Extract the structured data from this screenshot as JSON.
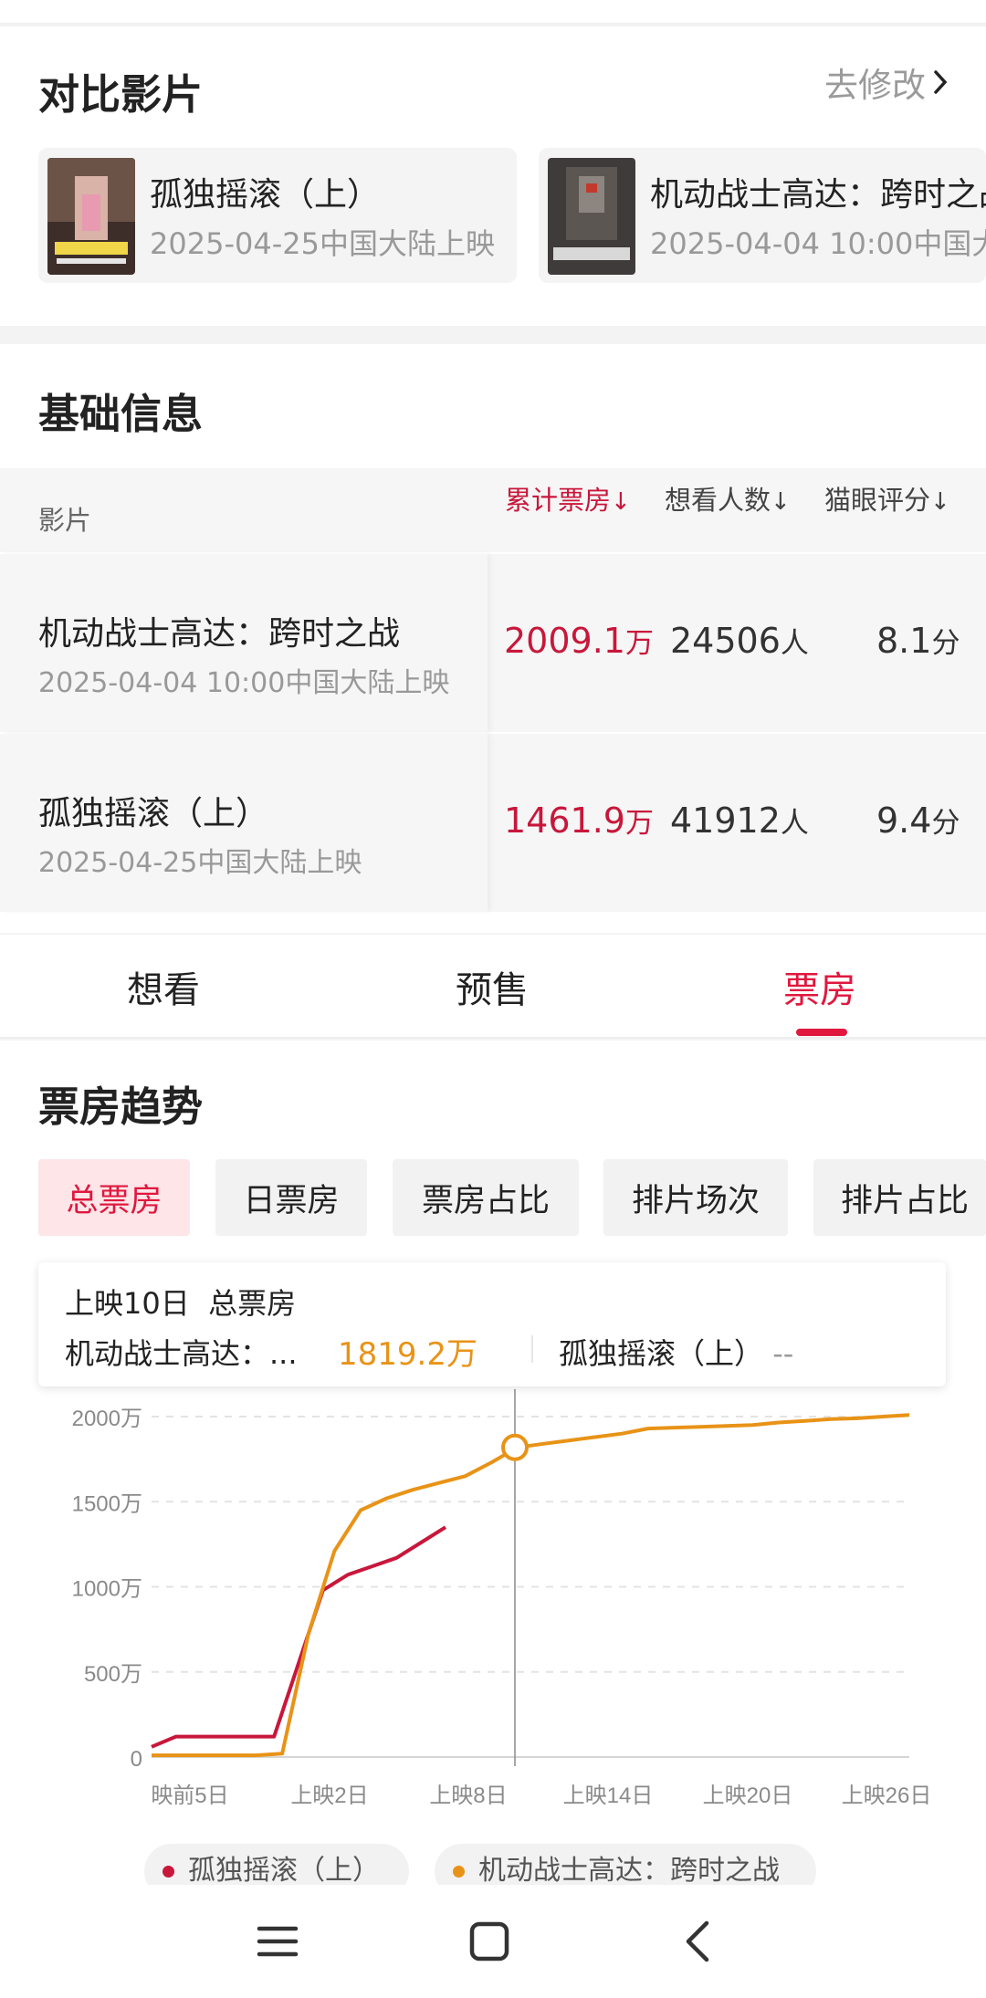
{
  "compare": {
    "title": "对比影片",
    "edit_label": "去修改",
    "films": [
      {
        "title": "孤独摇滚（上）",
        "date": "2025-04-25中国大陆上映"
      },
      {
        "title": "机动战士高达：跨时之战",
        "date": "2025-04-04 10:00中国大陆上映"
      }
    ]
  },
  "basic": {
    "title": "基础信息",
    "headers": {
      "film": "影片",
      "box": "累计票房",
      "want": "想看人数",
      "score": "猫眼评分"
    },
    "rows": [
      {
        "title": "机动战士高达：跨时之战",
        "date": "2025-04-04 10:00中国大陆上映",
        "box": "2009.1",
        "box_unit": "万",
        "want": "24506",
        "want_unit": "人",
        "score": "8.1",
        "score_unit": "分"
      },
      {
        "title": "孤独摇滚（上）",
        "date": "2025-04-25中国大陆上映",
        "box": "1461.9",
        "box_unit": "万",
        "want": "41912",
        "want_unit": "人",
        "score": "9.4",
        "score_unit": "分"
      }
    ]
  },
  "tabs": {
    "want": "想看",
    "presale": "预售",
    "box": "票房",
    "active": "票房"
  },
  "trend": {
    "title": "票房趋势",
    "pills": [
      "总票房",
      "日票房",
      "票房占比",
      "排片场次",
      "排片占比"
    ],
    "active_pill": "总票房",
    "tooltip": {
      "day": "上映10日",
      "metric": "总票房",
      "film_a": "机动战士高达：...",
      "film_a_value": "1819.2万",
      "film_b": "孤独摇滚（上）",
      "film_b_value": "--"
    },
    "legend": [
      "孤独摇滚（上）",
      "机动战士高达：跨时之战"
    ]
  },
  "chart_data": {
    "type": "line",
    "y_ticks": [
      "2000万",
      "1500万",
      "1000万",
      "500万",
      "0"
    ],
    "x_ticks": [
      "映前5日",
      "上映2日",
      "上映8日",
      "上映14日",
      "上映20日",
      "上映26日"
    ],
    "ylim": [
      0,
      2000
    ],
    "y_unit": "万",
    "x_index_labels": "day index: -5 = 映前5日, 1 = 上映1日",
    "series": [
      {
        "name": "孤独摇滚（上）",
        "color": "#c8173b",
        "points": [
          [
            -6,
            60
          ],
          [
            -5,
            120
          ],
          [
            -4,
            120
          ],
          [
            -3,
            120
          ],
          [
            -2,
            120
          ],
          [
            -1,
            120
          ],
          [
            0,
            550
          ],
          [
            1,
            980
          ],
          [
            2,
            1070
          ],
          [
            3,
            1120
          ],
          [
            4,
            1170
          ],
          [
            5,
            1260
          ],
          [
            6,
            1350
          ]
        ]
      },
      {
        "name": "机动战士高达：跨时之战",
        "color": "#e89317",
        "points": [
          [
            -6,
            10
          ],
          [
            -5,
            10
          ],
          [
            -4,
            10
          ],
          [
            -3,
            10
          ],
          [
            -2,
            10
          ],
          [
            -1,
            20
          ],
          [
            0,
            720
          ],
          [
            1,
            1210
          ],
          [
            2,
            1450
          ],
          [
            3,
            1520
          ],
          [
            4,
            1570
          ],
          [
            5,
            1610
          ],
          [
            6,
            1650
          ],
          [
            7,
            1730
          ],
          [
            8,
            1819
          ],
          [
            9,
            1840
          ],
          [
            10,
            1860
          ],
          [
            11,
            1880
          ],
          [
            12,
            1900
          ],
          [
            13,
            1930
          ],
          [
            14,
            1935
          ],
          [
            15,
            1940
          ],
          [
            16,
            1945
          ],
          [
            17,
            1950
          ],
          [
            18,
            1965
          ],
          [
            19,
            1975
          ],
          [
            20,
            1985
          ],
          [
            21,
            1990
          ],
          [
            22,
            2000
          ],
          [
            23,
            2009
          ]
        ]
      }
    ],
    "highlight_point": [
      8,
      1819
    ],
    "colors": {
      "accent": "#e0183e",
      "series_a": "#c8173b",
      "series_b": "#e89317"
    }
  }
}
